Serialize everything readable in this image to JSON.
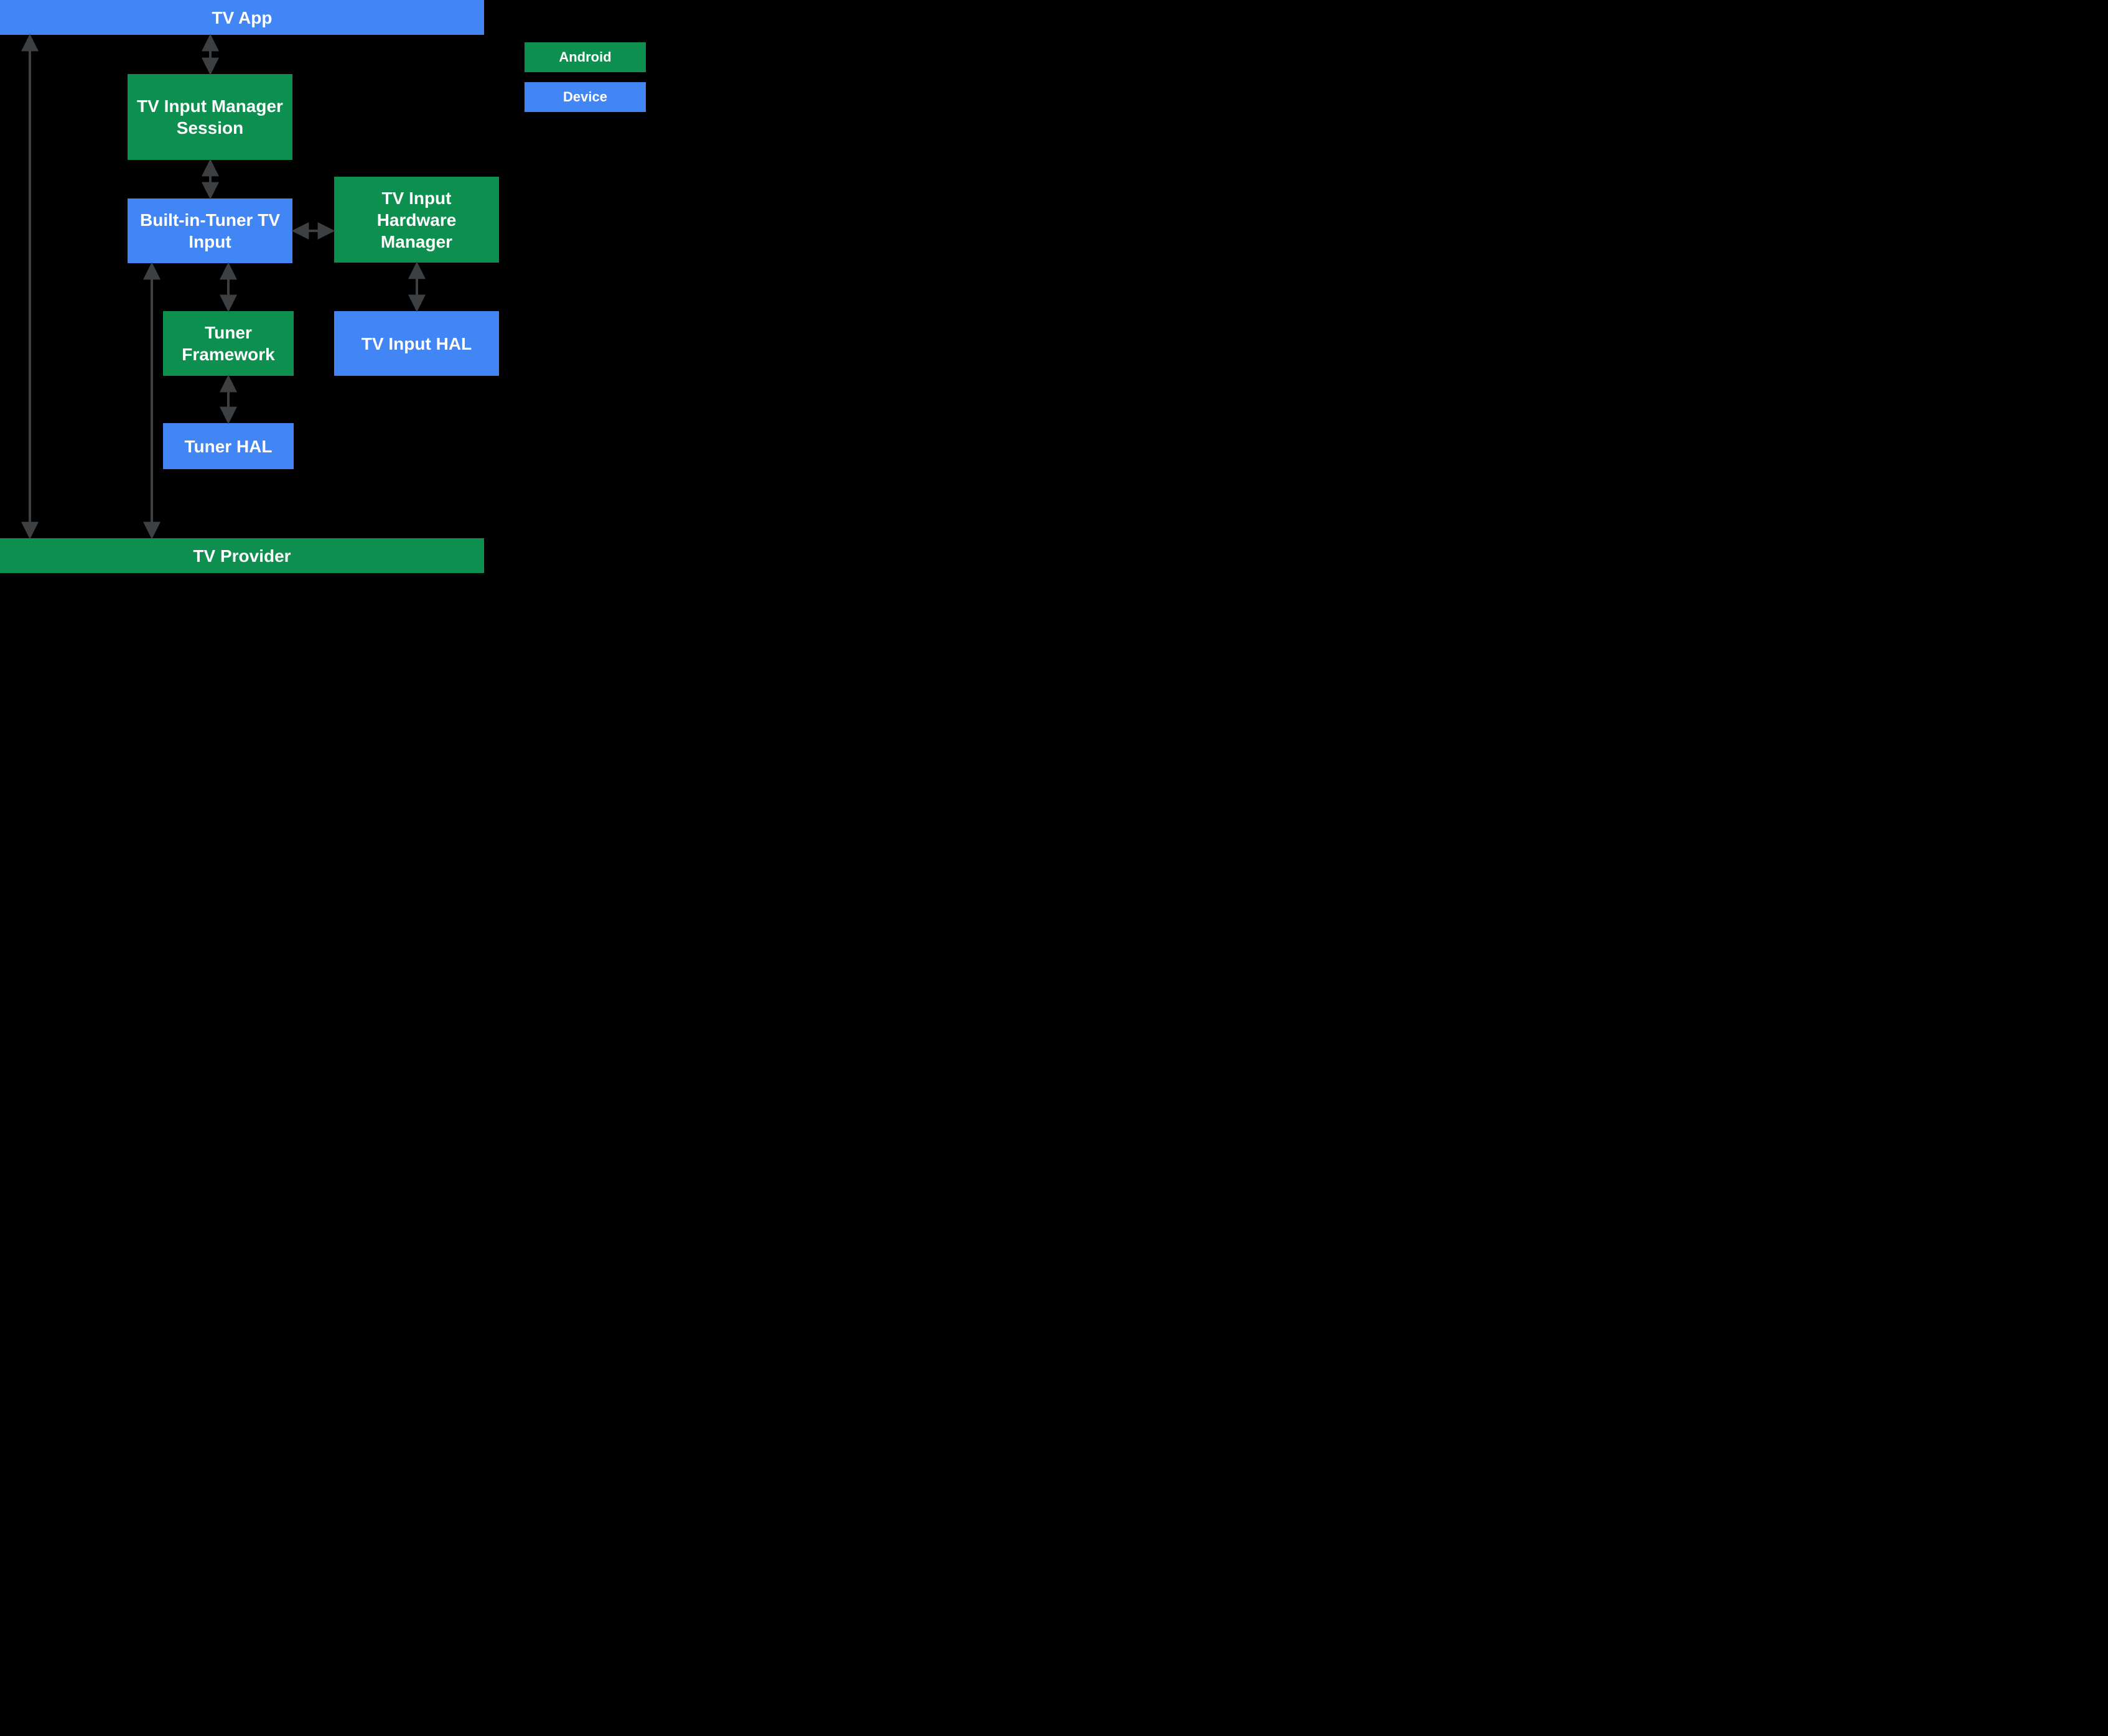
{
  "colors": {
    "blue": "#4285f4",
    "green": "#0d904f",
    "arrow": "#3c4043"
  },
  "legend": {
    "android": "Android",
    "device": "Device"
  },
  "nodes": {
    "tv_app": "TV App",
    "tim_session": "TV Input Manager Session",
    "built_in_tuner": "Built-in-Tuner TV Input",
    "ti_hw_manager": "TV Input Hardware Manager",
    "tuner_framework": "Tuner Framework",
    "tv_input_hal": "TV Input HAL",
    "tuner_hal": "Tuner HAL",
    "tv_provider": "TV Provider"
  }
}
